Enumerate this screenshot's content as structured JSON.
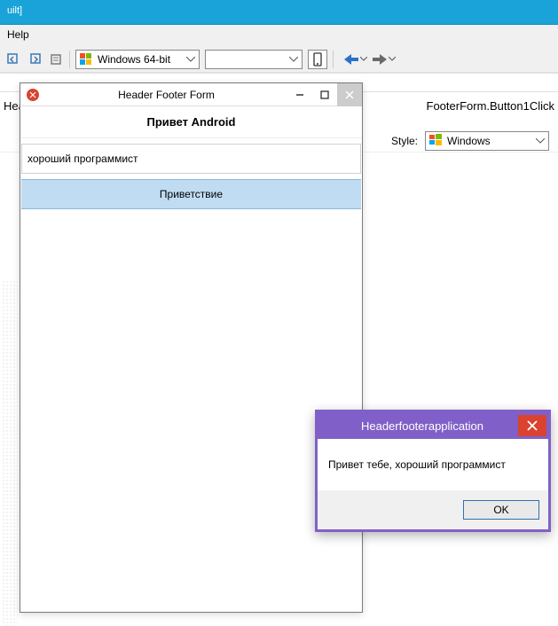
{
  "titlebar": {
    "fragment": "uilt]"
  },
  "menu": {
    "help": "Help"
  },
  "toolbar": {
    "platform_label": "Windows 64-bit"
  },
  "editor": {
    "truncated_tab": "Hea",
    "full_tab": "FooterForm.Button1Click"
  },
  "style": {
    "label": "Style:",
    "value": "Windows"
  },
  "app_window": {
    "title": "Header Footer Form",
    "header": "Привет Android",
    "input_value": "хороший программист",
    "button_label": "Приветствие"
  },
  "messagebox": {
    "title": "Headerfooterapplication",
    "text": "Привет тебе, хороший программист",
    "ok": "OK"
  }
}
